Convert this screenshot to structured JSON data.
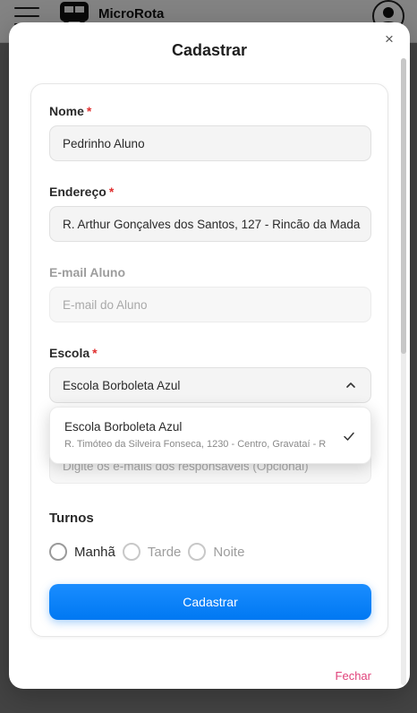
{
  "app": {
    "brand": "MicroRota"
  },
  "modal": {
    "title": "Cadastrar",
    "close_symbol": "×",
    "close_link": "Fechar"
  },
  "form": {
    "required_mark": "*",
    "nome": {
      "label": "Nome",
      "value": "Pedrinho Aluno"
    },
    "endereco": {
      "label": "Endereço",
      "value": "R. Arthur Gonçalves dos Santos, 127 - Rincão da Mada"
    },
    "email_aluno": {
      "label": "E-mail Aluno",
      "placeholder": "E-mail do Aluno"
    },
    "escola": {
      "label": "Escola",
      "selected": "Escola Borboleta Azul",
      "options": [
        {
          "title": "Escola Borboleta Azul",
          "subtitle": "R. Timóteo da Silveira Fonseca, 1230 - Centro, Gravataí - R"
        }
      ]
    },
    "responsaveis": {
      "placeholder": "Digite os e-mails dos responsáveis (Opcional)"
    },
    "turnos": {
      "title": "Turnos",
      "options": [
        "Manhã",
        "Tarde",
        "Noite"
      ]
    },
    "submit_label": "Cadastrar"
  },
  "colors": {
    "primary": "#0078f2",
    "required": "#e03030",
    "link": "#e0417a"
  },
  "icons": {
    "menu": "hamburger-icon",
    "logo": "bus-icon",
    "user": "user-icon",
    "close": "close-icon",
    "chevron": "chevron-up-icon",
    "check": "check-icon"
  }
}
